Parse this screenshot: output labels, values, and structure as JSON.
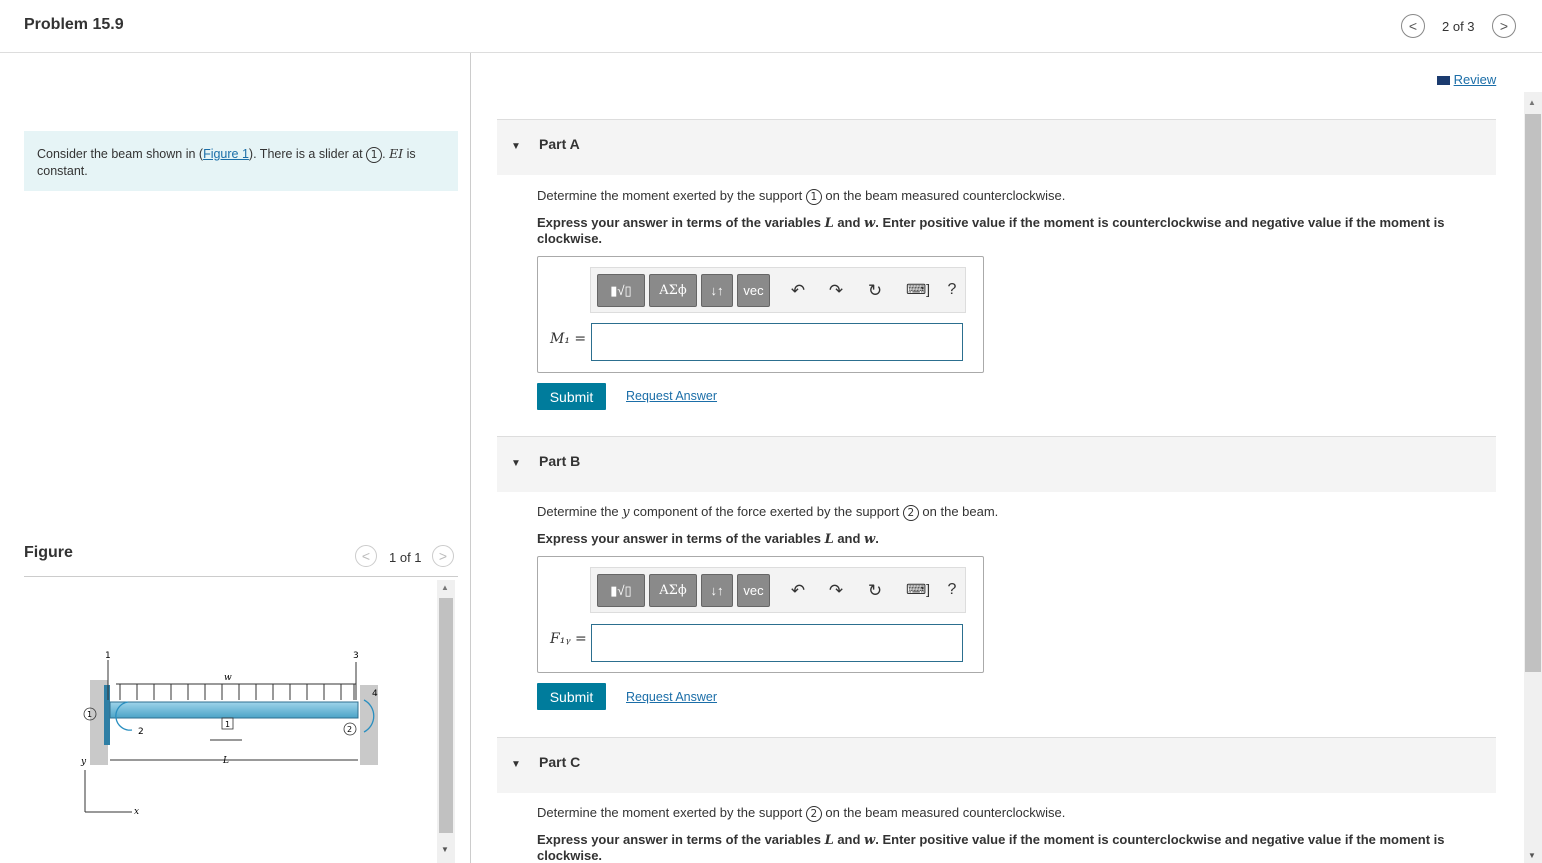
{
  "header": {
    "title": "Problem 15.9",
    "page_indicator": "2 of 3",
    "prev": "<",
    "next": ">"
  },
  "left": {
    "intro_pre": "Consider the beam shown in (",
    "intro_link": "Figure 1",
    "intro_mid": "). There is a slider at ",
    "intro_circ": "1",
    "intro_ei": "EI",
    "intro_post": " is constant.",
    "figure_label": "Figure",
    "figure_page": "1 of 1"
  },
  "figure": {
    "labels": {
      "n1": "1",
      "n2": "2",
      "n3": "3",
      "n4": "4",
      "w": "w",
      "L": "L",
      "x": "x",
      "y": "y",
      "s1": "1",
      "s2": "2",
      "slider": "1"
    }
  },
  "review": "Review",
  "parts": [
    {
      "label": "Part A",
      "q_pre": "Determine the moment exerted by the support ",
      "q_circ": "1",
      "q_post": " on the beam measured counterclockwise.",
      "express_pre": "Express your answer in terms of the variables ",
      "var1": "L",
      "and": " and ",
      "var2": "w",
      "express_post": ". Enter positive value if the moment is counterclockwise and negative value if the moment is clockwise.",
      "input_label": "M₁ =",
      "input_value": "",
      "submit": "Submit",
      "request": "Request Answer"
    },
    {
      "label": "Part B",
      "q_pre": "Determine the ",
      "q_var": "y",
      "q_mid": " component of the force exerted by the support ",
      "q_circ": "2",
      "q_post": " on the beam.",
      "express_pre": "Express your answer in terms of the variables ",
      "var1": "L",
      "and": " and ",
      "var2": "w",
      "express_post": ".",
      "input_label": "F₁ᵧ =",
      "input_value": "",
      "submit": "Submit",
      "request": "Request Answer"
    },
    {
      "label": "Part C",
      "q_pre": "Determine the moment exerted by the support ",
      "q_circ": "2",
      "q_post": " on the beam measured counterclockwise.",
      "express_pre": "Express your answer in terms of the variables ",
      "var1": "L",
      "and": " and ",
      "var2": "w",
      "express_post": ". Enter positive value if the moment is counterclockwise and negative value if the moment is clockwise."
    }
  ],
  "toolbar": {
    "templates": "▮√▯",
    "greek": "ΑΣϕ",
    "arrows": "↓↑",
    "vec": "vec",
    "undo": "↶",
    "redo": "↷",
    "reset": "↻",
    "keyboard": "⌨]",
    "help": "?"
  }
}
